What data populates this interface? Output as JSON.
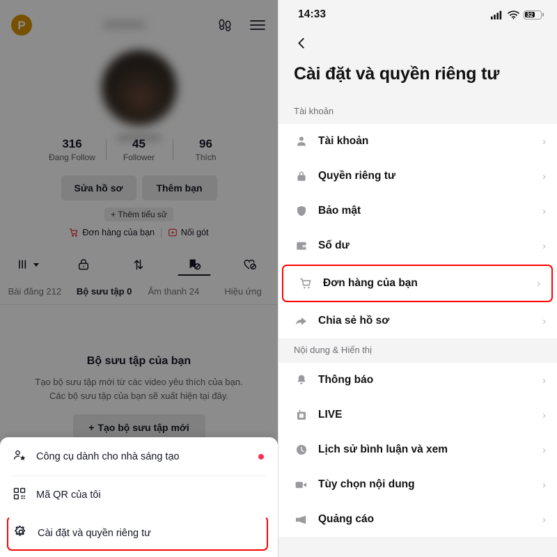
{
  "left": {
    "topbar": {
      "badge_letter": "P",
      "username_blurred": "••••••••••",
      "footprints_icon": "footprints-icon",
      "menu_icon": "hamburger-menu-icon"
    },
    "profile": {
      "handle_blurred": "••••••••••••",
      "stats": [
        {
          "num": "316",
          "label": "Đang Follow"
        },
        {
          "num": "45",
          "label": "Follower"
        },
        {
          "num": "96",
          "label": "Thích"
        }
      ],
      "edit_profile": "Sửa hồ sơ",
      "add_friend": "Thêm bạn",
      "add_bio": "+ Thêm tiểu sử",
      "orders_link": "Đơn hàng của bạn",
      "follow_link": "Nối gót"
    },
    "tabs": [
      {
        "icon": "grid-columns-icon",
        "label": "Bài đăng 212",
        "active": false
      },
      {
        "icon": "lock-icon",
        "label": "Bộ sưu tập 0",
        "active": false
      },
      {
        "icon": "repost-icon",
        "label": "Âm thanh 24",
        "active": false
      },
      {
        "icon": "collection-private-icon",
        "label": "Hiệu ứng",
        "active": true
      },
      {
        "icon": "heart-private-icon",
        "label": "",
        "active": false
      }
    ],
    "empty_state": {
      "title": "Bộ sưu tập của bạn",
      "line1": "Tạo bộ sưu tập mới từ các video yêu thích của bạn.",
      "line2": "Các bộ sưu tập của bạn sẽ xuất hiện tại đây.",
      "create_button": "Tạo bộ sưu tập mới"
    },
    "sheet": {
      "items": [
        {
          "icon": "creator-tools-icon",
          "label": "Công cụ dành cho nhà sáng tạo",
          "dot": true,
          "highlight": false
        },
        {
          "icon": "qr-code-icon",
          "label": "Mã QR của tôi",
          "dot": false,
          "highlight": false
        },
        {
          "icon": "gear-icon",
          "label": "Cài đặt và quyền riêng tư",
          "dot": false,
          "highlight": true
        }
      ]
    }
  },
  "right": {
    "statusbar": {
      "time": "14:33",
      "cellular_icon": "cellular-signal-icon",
      "wifi_icon": "wifi-icon",
      "battery_level": "32"
    },
    "back_icon": "chevron-left-icon",
    "title": "Cài đặt và quyền riêng tư",
    "sections": [
      {
        "header": "Tài khoản",
        "rows": [
          {
            "icon": "person-icon",
            "label": "Tài khoản",
            "highlight": false
          },
          {
            "icon": "lock-icon",
            "label": "Quyền riêng tư",
            "highlight": false
          },
          {
            "icon": "shield-icon",
            "label": "Bảo mật",
            "highlight": false
          },
          {
            "icon": "wallet-icon",
            "label": "Số dư",
            "highlight": false
          },
          {
            "icon": "shopping-cart-icon",
            "label": "Đơn hàng của bạn",
            "highlight": true
          },
          {
            "icon": "share-arrow-icon",
            "label": "Chia sẻ hồ sơ",
            "highlight": false
          }
        ]
      },
      {
        "header": "Nội dung & Hiển thị",
        "rows": [
          {
            "icon": "bell-icon",
            "label": "Thông báo",
            "highlight": false
          },
          {
            "icon": "live-tv-icon",
            "label": "LIVE",
            "highlight": false
          },
          {
            "icon": "clock-icon",
            "label": "Lịch sử bình luận và xem",
            "highlight": false
          },
          {
            "icon": "video-camera-icon",
            "label": "Tùy chọn nội dung",
            "highlight": false
          },
          {
            "icon": "megaphone-icon",
            "label": "Quảng cáo",
            "highlight": false
          }
        ]
      }
    ],
    "chevron": "›"
  },
  "colors": {
    "highlight_red": "#ff0000",
    "accent_pink": "#fe2c55",
    "badge_gold": "#d99400",
    "panel_bg": "#f4f4f4"
  }
}
